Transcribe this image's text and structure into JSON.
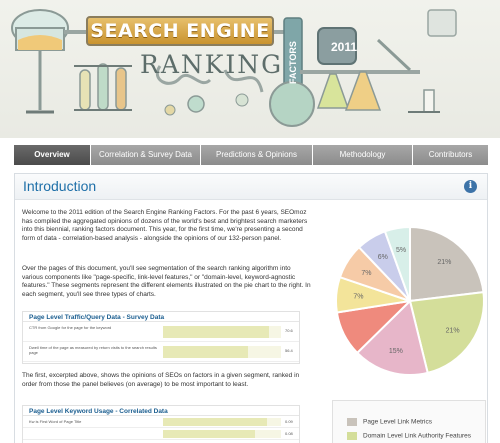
{
  "header": {
    "title": "SEARCH ENGINE",
    "script_word": "RANKING",
    "factors_word": "FACTORS",
    "year": "2011"
  },
  "nav": {
    "tabs": [
      {
        "label": "Overview",
        "active": true
      },
      {
        "label": "Correlation & Survey Data",
        "active": false
      },
      {
        "label": "Predictions & Opinions",
        "active": false
      },
      {
        "label": "Methodology",
        "active": false
      },
      {
        "label": "Contributors",
        "active": false
      }
    ]
  },
  "intro": {
    "title": "Introduction",
    "info_icon": "i",
    "paragraph1": "Welcome to the 2011 edition of the Search Engine Ranking Factors. For the past 6 years, SEOmoz has compiled the aggregated opinions of dozens of the world's best and brightest search marketers into this biennial, ranking factors document. This year, for the first time, we're presenting a second form of data - correlation-based analysis - alongside the opinions of our 132-person panel.",
    "paragraph2": "Over the pages of this document, you'll see segmentation of the search ranking algorithm into various components like \"page-specific, link-level features,\" or \"domain-level, keyword-agnostic features.\" These segments represent the different elements illustrated on the pie chart to the right. In each segment, you'll see three types of charts.",
    "paragraph3": "The first, excerpted above, shows the opinions of SEOs on factors in a given segment, ranked in order from those the panel believes (on average) to be most important to least."
  },
  "panel1": {
    "title": "Page Level Traffic/Query Data - Survey Data",
    "rows": [
      {
        "label": "CTR from Google for the page for the keyword",
        "value": "70.6",
        "fill": 0.9
      },
      {
        "label": "Dwell time of the page as measured by return visits to the search results page",
        "value": "56.4",
        "fill": 0.72
      }
    ]
  },
  "panel2": {
    "title": "Page Level Keyword Usage - Correlated Data",
    "rows": [
      {
        "label": "Kw is First Word of Page Title",
        "value": "0.09",
        "fill": 0.88
      },
      {
        "label": "",
        "value": "0.08",
        "fill": 0.78
      }
    ]
  },
  "chart_data": {
    "type": "pie",
    "slices": [
      {
        "label": "21%",
        "value": 21,
        "color": "#c9c3bb"
      },
      {
        "label": "21%",
        "value": 21,
        "color": "#d4de9a"
      },
      {
        "label": "15%",
        "value": 15,
        "color": "#e7b6c9"
      },
      {
        "label": "",
        "value": 9,
        "color": "#ef8a7d"
      },
      {
        "label": "7%",
        "value": 7,
        "color": "#f3e49a"
      },
      {
        "label": "7%",
        "value": 7,
        "color": "#f6cba7"
      },
      {
        "label": "6%",
        "value": 6,
        "color": "#c9cdeb"
      },
      {
        "label": "5%",
        "value": 5,
        "color": "#d8efe9"
      }
    ],
    "legend": [
      {
        "label": "Page Level Link Metrics",
        "color": "#c9c3bb"
      },
      {
        "label": "Domain Level Link Authority Features",
        "color": "#d4de9a"
      }
    ]
  }
}
